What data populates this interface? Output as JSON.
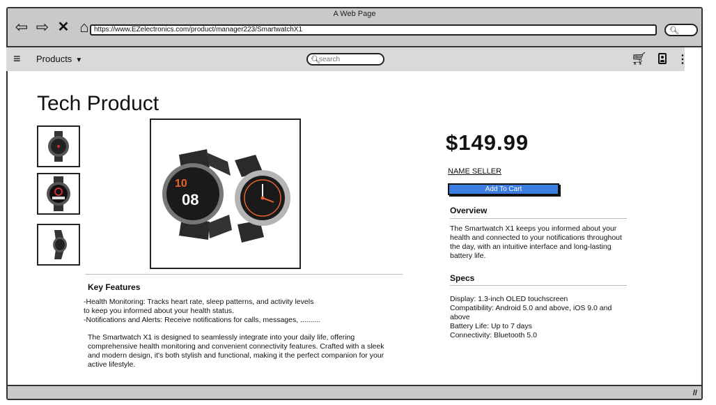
{
  "window": {
    "title": "A Web Page",
    "url": "https://www.EZelectronics.com/product/manager223/SmartwatchX1",
    "icons": [
      "back-arrow-icon",
      "forward-arrow-icon",
      "close-icon",
      "home-icon",
      "search-icon"
    ]
  },
  "toolbar": {
    "menu_icon": "hamburger-icon",
    "products_label": "Products",
    "search_placeholder": "search",
    "icons": [
      "cart-icon",
      "account-icon",
      "kebab-icon"
    ]
  },
  "product": {
    "title": "Tech Product",
    "price": "$149.99",
    "seller": "NAME SELLER",
    "add_to_cart_label": "Add To Cart",
    "thumbnails": [
      "watch-front-thumbnail",
      "watch-face-thumbnail",
      "watch-side-thumbnail"
    ]
  },
  "key_features": {
    "title": "Key Features",
    "lines": [
      "-Health Monitoring: Tracks heart rate, sleep patterns, and activity levels",
      "to keep you informed about your health status.",
      "-Notifications and Alerts: Receive notifications for calls, messages, .........."
    ],
    "description": "The Smartwatch X1 is designed to seamlessly integrate into your daily life, offering comprehensive health monitoring and convenient connectivity features. Crafted with a sleek and modern design, it's both stylish and functional, making it the perfect companion for your active lifestyle."
  },
  "overview": {
    "title": "Overview",
    "text": "The Smartwatch X1 keeps you informed about your health and connected to your notifications throughout the day, with an intuitive interface and long-lasting battery life."
  },
  "specs": {
    "title": "Specs",
    "lines": [
      "Display: 1.3-inch OLED touchscreen",
      "Compatibility: Android 5.0 and above, iOS 9.0 and above",
      "Battery Life: Up to 7 days",
      "Connectivity: Bluetooth 5.0"
    ]
  },
  "colors": {
    "chrome": "#c9c9c9",
    "toolbar": "#d9d9d9",
    "accent": "#3b7de0"
  }
}
